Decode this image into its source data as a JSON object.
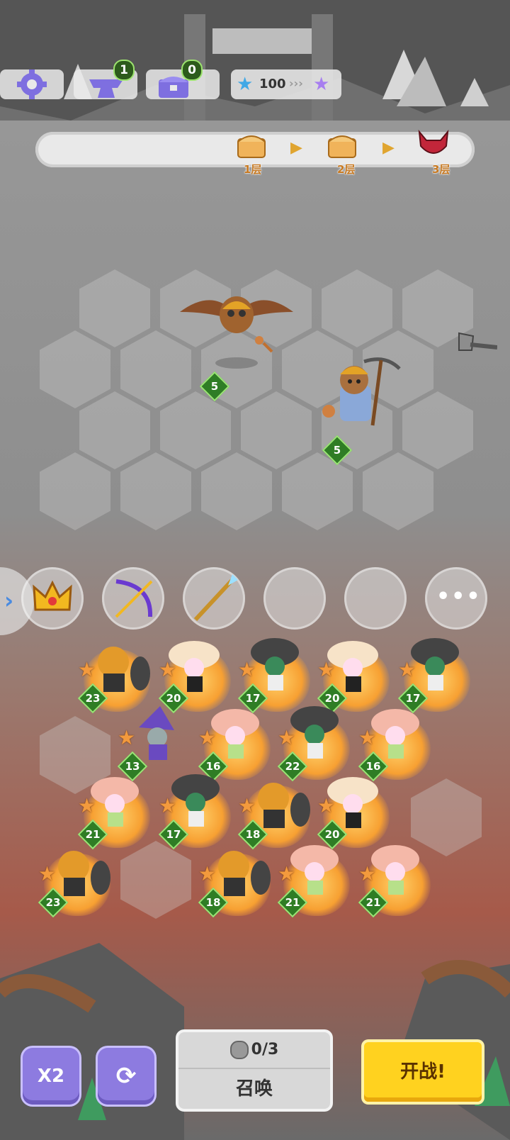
{
  "top_bar": {
    "settings_icon": "gear-icon",
    "anvil_icon": "anvil-icon",
    "anvil_count": "1",
    "chest_icon": "chest-icon",
    "chest_count": "0",
    "star_count": "100",
    "star_icon": "star-icon",
    "next_star_icon": "purple-star-icon"
  },
  "floors": [
    {
      "label": "1层",
      "icon": "chest-icon"
    },
    {
      "label": "2层",
      "icon": "chest-icon"
    },
    {
      "label": "3层",
      "icon": "boss-helmet-icon"
    }
  ],
  "enemies": [
    {
      "name": "bat-miner",
      "level": "5"
    },
    {
      "name": "bear-miner",
      "level": "5"
    }
  ],
  "items": [
    {
      "icon": "crown-icon"
    },
    {
      "icon": "bow-icon"
    },
    {
      "icon": "spear-icon"
    },
    {
      "icon": "empty-slot"
    },
    {
      "icon": "empty-slot"
    },
    {
      "icon": "more-icon"
    }
  ],
  "heroes": [
    {
      "name": "pumpkin-knight",
      "level": "23"
    },
    {
      "name": "mushroom-witch",
      "level": "20"
    },
    {
      "name": "turban-mushroom",
      "level": "17"
    },
    {
      "name": "mushroom-witch",
      "level": "20"
    },
    {
      "name": "turban-mushroom",
      "level": "17"
    },
    {
      "name": "purple-wizard",
      "level": "13"
    },
    {
      "name": "pink-mushroom",
      "level": "16"
    },
    {
      "name": "turban-mushroom",
      "level": "22"
    },
    {
      "name": "pink-mushroom",
      "level": "16"
    },
    {
      "name": "pink-mushroom",
      "level": "21"
    },
    {
      "name": "turban-mushroom",
      "level": "17"
    },
    {
      "name": "pumpkin-knight",
      "level": "18"
    },
    {
      "name": "mushroom-witch",
      "level": "20"
    },
    {
      "name": "pumpkin-knight",
      "level": "23"
    },
    {
      "name": "pumpkin-knight",
      "level": "18"
    },
    {
      "name": "pink-mushroom",
      "level": "21"
    },
    {
      "name": "pink-mushroom",
      "level": "21"
    }
  ],
  "bottom": {
    "speed_label": "X2",
    "refresh_icon": "refresh-icon",
    "summon_count": "0/3",
    "summon_label": "召唤",
    "fight_label": "开战!"
  },
  "colors": {
    "fight_button": "#ffd21f",
    "speed_button": "#8d7be0",
    "level_badge": "#2f7d25"
  }
}
